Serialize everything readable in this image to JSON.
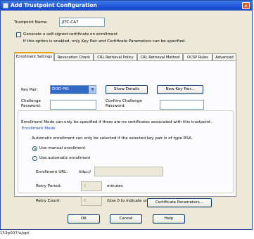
{
  "window": {
    "title": "Add Trustpoint Configuration",
    "close_glyph": "✕"
  },
  "trustpoint": {
    "label": "Trustpoint Name:",
    "value": "JITC-CA7"
  },
  "self_signed": {
    "label": "Generate a self-signed certificate on enrollment",
    "note": "If this option is enabled, only Key Pair and Certificate Parameters can be specified.",
    "checked": false
  },
  "tabs": [
    {
      "label": "Enrollment Settings",
      "active": true
    },
    {
      "label": "Revocation Check",
      "active": false
    },
    {
      "label": "CRL Retrieval Policy",
      "active": false
    },
    {
      "label": "CRL Retrieval Method",
      "active": false
    },
    {
      "label": "OCSP Rules",
      "active": false
    },
    {
      "label": "Advanced",
      "active": false
    }
  ],
  "enroll": {
    "key_pair_label": "Key Pair:",
    "key_pair_value": "DOD-PKI",
    "show_details": "Show Details",
    "new_key_pair": "New Key Pair...",
    "challenge_label_1": "Challenge",
    "challenge_label_2": "Password:",
    "confirm_label_1": "Confirm Challenge",
    "confirm_label_2": "Password:",
    "challenge_value": "",
    "confirm_value": "",
    "mode_note": "Enrollment Mode can only be specified if there are no certificates associated with this trustpoint."
  },
  "mode": {
    "legend": "Enrollment Mode",
    "note": "Automatic enrollment can only be selected if the selected key pair is of type RSA.",
    "manual_label": "Use manual enrollment",
    "auto_label": "Use automatic enrollment",
    "selected": "manual",
    "url_label": "Enrollment URL:",
    "url_prefix": "http://",
    "url_value": "",
    "retry_period_label": "Retry Period:",
    "retry_period_value": "1",
    "retry_period_unit": "minutes",
    "retry_count_label": "Retry Count:",
    "retry_count_value": "0",
    "retry_count_note": "(Use 0 to indicate unlimited retries)"
  },
  "cert_params": "Certificate Parameters...",
  "footer": {
    "ok": "OK",
    "cancel": "Cancel",
    "help": "Help"
  },
  "caption": "153p007/a/ppt"
}
